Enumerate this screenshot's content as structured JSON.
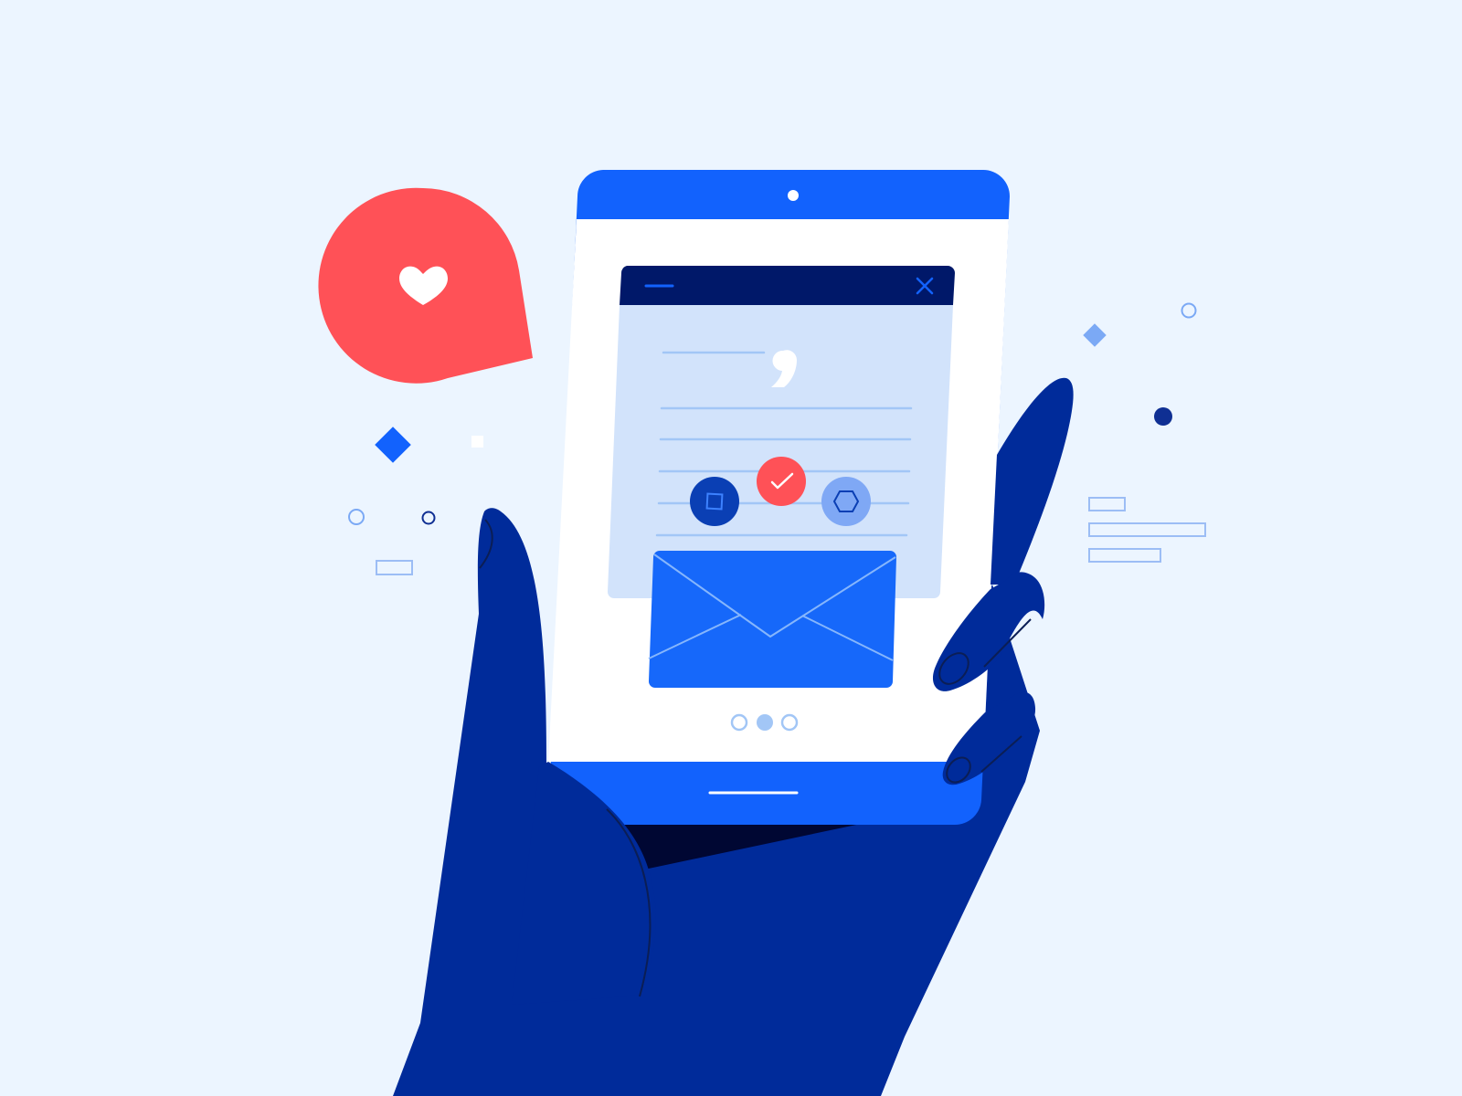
{
  "illustration": {
    "subject": "hand-holding-phone-with-message",
    "colors": {
      "background": "#ecf5ff",
      "hand": "#002b9a",
      "hand_shadow": "#000733",
      "phone_frame": "#1262fd",
      "screen": "#ffffff",
      "dialog_header": "#001869",
      "dialog_body": "#d2e3fb",
      "text_lines": "#a2c6f6",
      "envelope": "#1668fa",
      "envelope_lines": "#86b6fc",
      "accent_red": "#ff5157",
      "reaction_square_bg": "#0a3fb4",
      "reaction_hex_bg": "#7fa8f5",
      "decor_light": "#7ba9f5",
      "decor_dark": "#0f2f93"
    },
    "icons": [
      "heart-icon",
      "speech-bubble-icon",
      "minimize-icon",
      "close-icon",
      "quote-icon",
      "square-icon",
      "checkmark-icon",
      "hexagon-icon",
      "envelope-icon",
      "camera-icon",
      "home-indicator-icon"
    ],
    "reactions": [
      "square",
      "check",
      "hexagon"
    ],
    "pagination": {
      "total": 3,
      "active": 2
    }
  }
}
